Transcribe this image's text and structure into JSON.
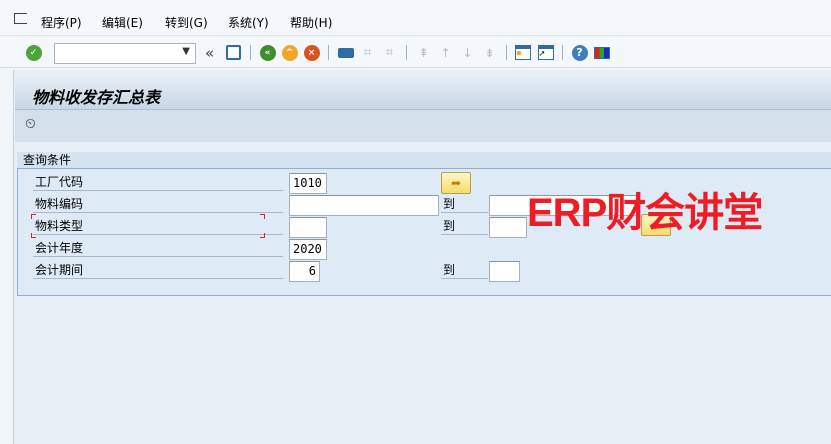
{
  "menu": {
    "items": [
      "程序(P)",
      "编辑(E)",
      "转到(G)",
      "系统(Y)",
      "帮助(H)"
    ]
  },
  "toolbar": {
    "command_value": "",
    "back_label": "«"
  },
  "page": {
    "title": "物料收发存汇总表"
  },
  "group": {
    "title": "查询条件"
  },
  "fields": [
    {
      "label": "工厂代码",
      "value": "1010"
    },
    {
      "label": "物料编码",
      "value": "",
      "to_label": "到",
      "to_value": ""
    },
    {
      "label": "物料类型",
      "value": "",
      "to_label": "到",
      "to_value": ""
    },
    {
      "label": "会计年度",
      "value": "2020"
    },
    {
      "label": "会计期间",
      "value": "6",
      "to_label": "到",
      "to_value": ""
    }
  ],
  "watermark": "ERP财会讲堂"
}
